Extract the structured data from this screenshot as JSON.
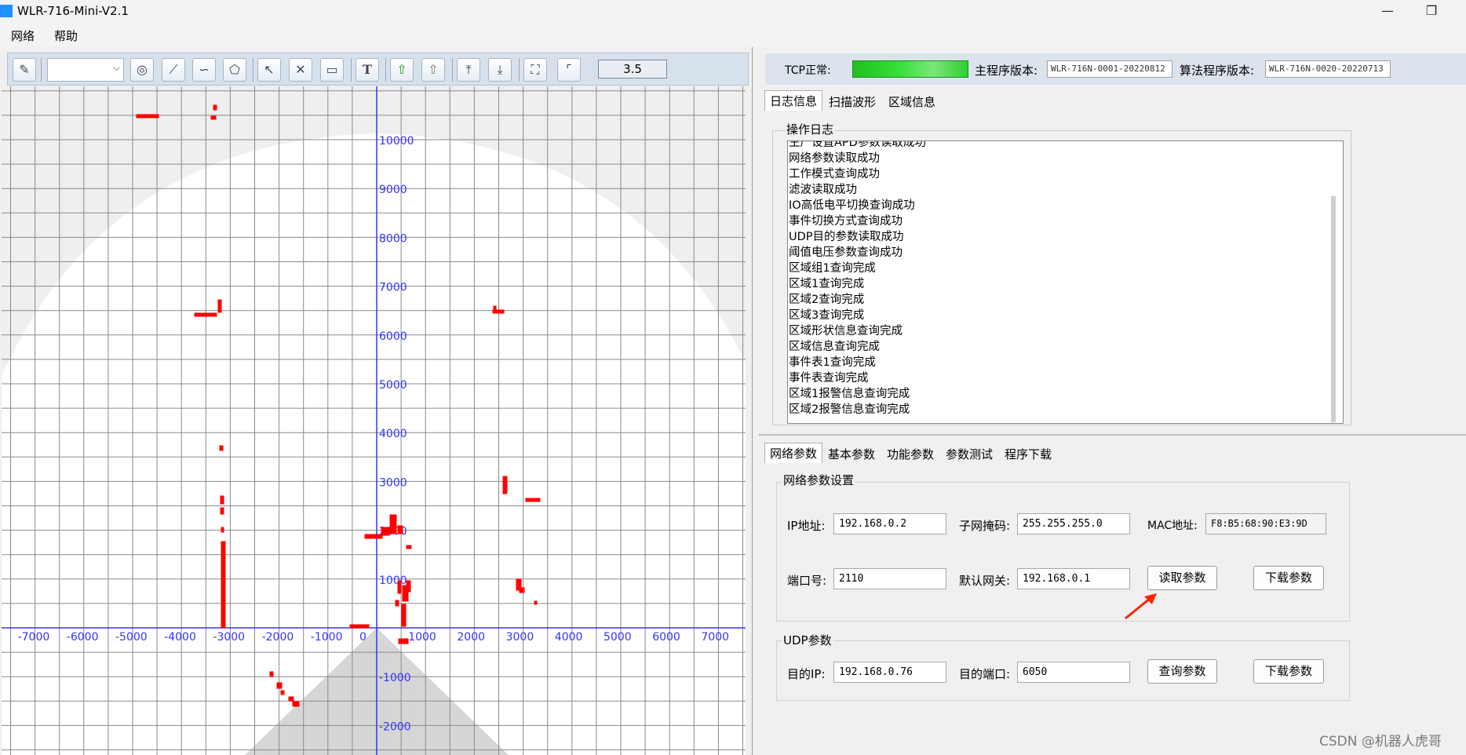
{
  "window": {
    "title": "WLR-716-Mini-V2.1",
    "minimize_glyph": "—",
    "restore_glyph": "❐"
  },
  "menu": [
    "网络",
    "帮助"
  ],
  "toolbar": {
    "zoom_value": "3.5",
    "icons": [
      "edit-icon",
      "circle-icon",
      "line-icon",
      "freeform-icon",
      "polygon-icon",
      "select-arrow-icon",
      "delete-icon",
      "region-icon",
      "text-icon",
      "upload-green-icon",
      "upload-gray-icon",
      "export-icon",
      "import-icon",
      "fit-icon",
      "frame-icon"
    ]
  },
  "plot": {
    "x_tick_labels": [
      "-7000",
      "-6000",
      "-5000",
      "-4000",
      "-3000",
      "-2000",
      "-1000",
      "0",
      "1000",
      "2000",
      "3000",
      "4000",
      "5000",
      "6000",
      "7000"
    ],
    "y_tick_labels": [
      "10000",
      "9000",
      "8000",
      "7000",
      "6000",
      "5000",
      "4000",
      "3000",
      "2000",
      "1000",
      "-1000",
      "-2000"
    ],
    "axis_color": "#3333ff",
    "point_color": "#ff0000",
    "grid_color": "#8a8a8a"
  },
  "status": {
    "tcp_label": "TCP正常:",
    "main_version_label": "主程序版本:",
    "main_version_value": "WLR-716N-0001-20220812",
    "algo_version_label": "算法程序版本:",
    "algo_version_value": "WLR-716N-0020-20220713"
  },
  "top_tabs": [
    "日志信息",
    "扫描波形",
    "区域信息"
  ],
  "log": {
    "group_title": "操作日志",
    "lines": [
      "生产设置APD参数读取成功",
      "网络参数读取成功",
      "工作模式查询成功",
      "滤波读取成功",
      "IO高低电平切换查询成功",
      "事件切换方式查询成功",
      "UDP目的参数读取成功",
      "阈值电压参数查询成功",
      "区域组1查询完成",
      "区域1查询完成",
      "区域2查询完成",
      "区域3查询完成",
      "区域形状信息查询完成",
      "区域信息查询完成",
      "事件表1查询完成",
      "事件表查询完成",
      "区域1报警信息查询完成",
      "区域2报警信息查询完成"
    ]
  },
  "bottom_tabs": [
    "网络参数",
    "基本参数",
    "功能参数",
    "参数测试",
    "程序下载"
  ],
  "network": {
    "group_title": "网络参数设置",
    "ip_label": "IP地址:",
    "ip_value": "192.168.0.2",
    "subnet_label": "子网掩码:",
    "subnet_value": "255.255.255.0",
    "mac_label": "MAC地址:",
    "mac_value": "F8:B5:68:90:E3:9D",
    "port_label": "端口号:",
    "port_value": "2110",
    "gateway_label": "默认网关:",
    "gateway_value": "192.168.0.1",
    "read_button": "读取参数",
    "download_button": "下载参数"
  },
  "udp": {
    "group_title": "UDP参数",
    "dest_ip_label": "目的IP:",
    "dest_ip_value": "192.168.0.76",
    "dest_port_label": "目的端口:",
    "dest_port_value": "6050",
    "query_button": "查询参数",
    "download_button": "下载参数"
  },
  "watermark": "CSDN @机器人虎哥"
}
